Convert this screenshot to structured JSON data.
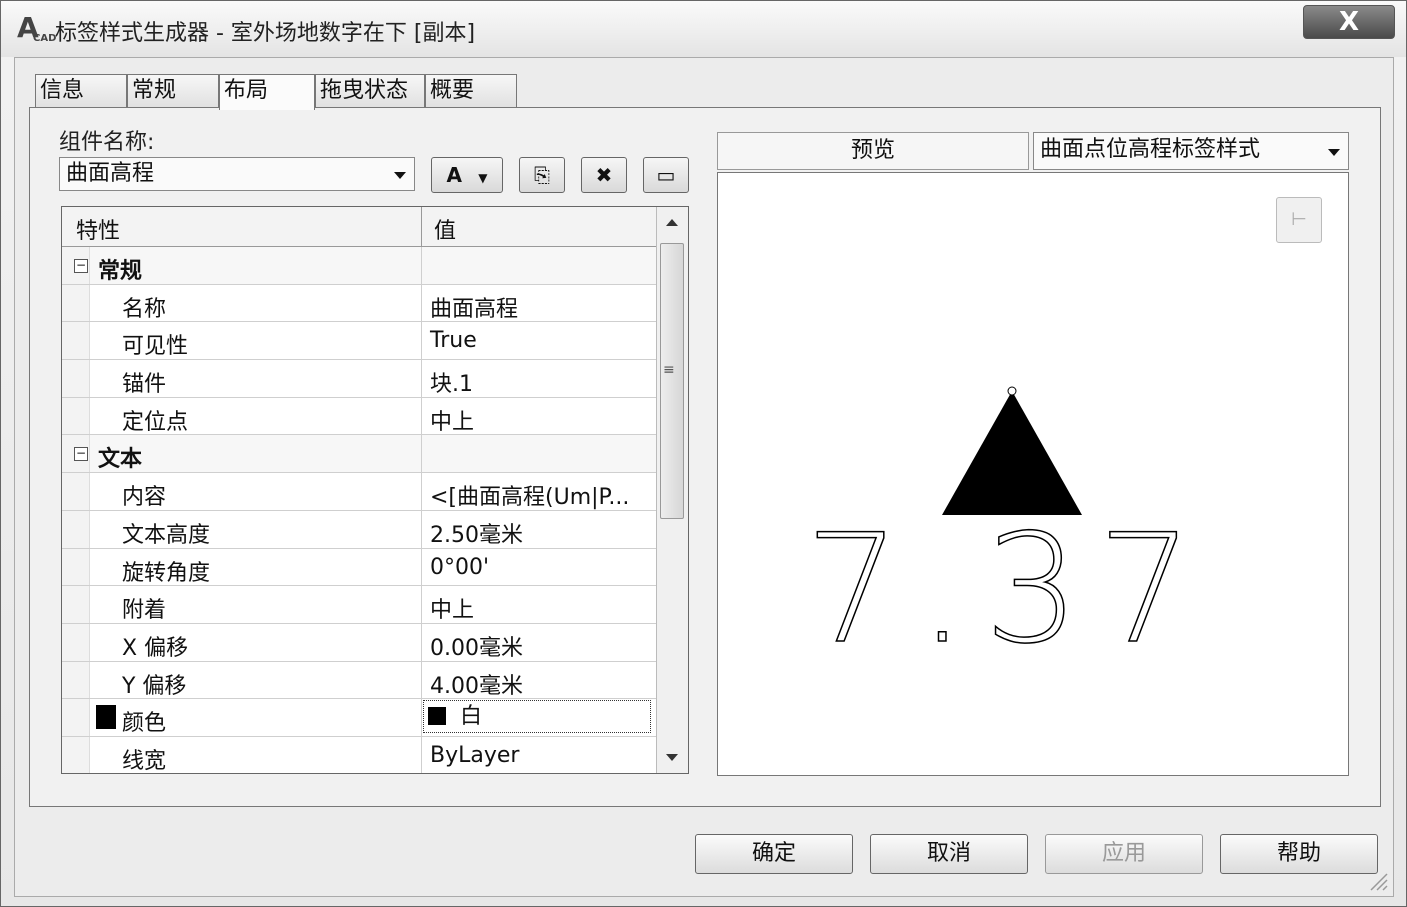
{
  "window": {
    "title": "标签样式生成器 - 室外场地数字在下 [副本]",
    "close_glyph": "X"
  },
  "tabs": [
    {
      "label": "信息"
    },
    {
      "label": "常规"
    },
    {
      "label": "布局"
    },
    {
      "label": "拖曳状态"
    },
    {
      "label": "概要"
    }
  ],
  "component": {
    "label": "组件名称:",
    "selected": "曲面高程"
  },
  "toolbar": {
    "text_component_glyph": "A",
    "copy_glyph": "⎘",
    "delete_glyph": "✖",
    "order_glyph": "▭"
  },
  "grid": {
    "header_property": "特性",
    "header_value": "值",
    "groups": [
      {
        "name": "常规",
        "rows": [
          {
            "name": "名称",
            "value": "曲面高程"
          },
          {
            "name": "可见性",
            "value": "True"
          },
          {
            "name": "锚件",
            "value": "块.1"
          },
          {
            "name": "定位点",
            "value": "中上"
          }
        ]
      },
      {
        "name": "文本",
        "rows": [
          {
            "name": "内容",
            "value": "<[曲面高程(Um|P..."
          },
          {
            "name": "文本高度",
            "value": "2.50毫米"
          },
          {
            "name": "旋转角度",
            "value": "0°00'"
          },
          {
            "name": "附着",
            "value": "中上"
          },
          {
            "name": "X 偏移",
            "value": "0.00毫米"
          },
          {
            "name": "Y 偏移",
            "value": "4.00毫米"
          },
          {
            "name": "颜色",
            "value": "白"
          },
          {
            "name": "线宽",
            "value": "ByLayer"
          }
        ]
      }
    ],
    "expander_glyph": "−"
  },
  "preview": {
    "label": "预览",
    "style_selected": "曲面点位高程标签样式",
    "sample_text": "7.37"
  },
  "buttons": {
    "ok": "确定",
    "cancel": "取消",
    "apply": "应用",
    "help": "帮助"
  }
}
